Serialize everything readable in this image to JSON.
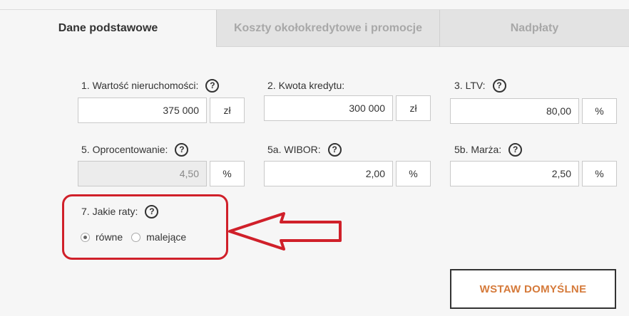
{
  "tabs": [
    {
      "label": "Dane podstawowe",
      "active": true
    },
    {
      "label": "Koszty okołokredytowe i promocje",
      "active": false
    },
    {
      "label": "Nadpłaty",
      "active": false
    }
  ],
  "fields": {
    "property_value": {
      "label": "1. Wartość nieruchomości:",
      "value": "375 000",
      "unit": "zł"
    },
    "loan_amount": {
      "label": "2. Kwota kredytu:",
      "value": "300 000",
      "unit": "zł"
    },
    "ltv": {
      "label": "3. LTV:",
      "value": "80,00",
      "unit": "%"
    },
    "interest": {
      "label": "5. Oprocentowanie:",
      "value": "4,50",
      "unit": "%"
    },
    "wibor": {
      "label": "5a. WIBOR:",
      "value": "2,00",
      "unit": "%"
    },
    "margin": {
      "label": "5b. Marża:",
      "value": "2,50",
      "unit": "%"
    }
  },
  "installments": {
    "label": "7. Jakie raty:",
    "options": [
      "równe",
      "malejące"
    ],
    "selected": "równe"
  },
  "help_glyph": "?",
  "reset_button": "WSTAW DOMYŚLNE",
  "colors": {
    "highlight": "#d0202a",
    "accent": "#d57a3a",
    "tab_inactive": "#e3e3e3"
  }
}
